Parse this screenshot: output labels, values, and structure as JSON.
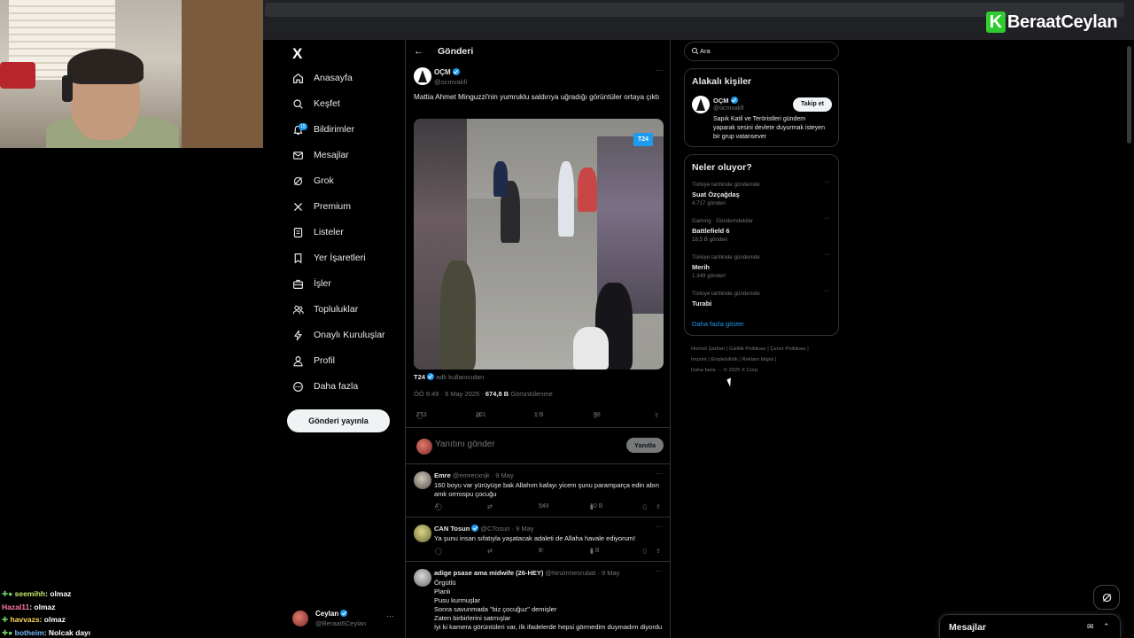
{
  "overlay": {
    "brand_letter": "K",
    "brand_name": "BeraatCeylan",
    "chat": [
      {
        "user": "seemihh",
        "text": ": olmaz"
      },
      {
        "user": "Hazal11",
        "text": ": olmaz"
      },
      {
        "user": "havvazs",
        "text": ": olmaz"
      },
      {
        "user": "botheim",
        "text": ": Nolcak dayı"
      }
    ]
  },
  "sidebar": {
    "logo": "X",
    "items": [
      {
        "label": "Anasayfa",
        "icon": "home-icon"
      },
      {
        "label": "Keşfet",
        "icon": "search-icon"
      },
      {
        "label": "Bildirimler",
        "icon": "bell-icon"
      },
      {
        "label": "Mesajlar",
        "icon": "mail-icon"
      },
      {
        "label": "Grok",
        "icon": "grok-icon"
      },
      {
        "label": "Premium",
        "icon": "x-logo-icon"
      },
      {
        "label": "Listeler",
        "icon": "list-icon"
      },
      {
        "label": "Yer İşaretleri",
        "icon": "bookmark-icon"
      },
      {
        "label": "İşler",
        "icon": "briefcase-icon"
      },
      {
        "label": "Topluluklar",
        "icon": "people-icon"
      },
      {
        "label": "Onaylı Kuruluşlar",
        "icon": "lightning-icon"
      },
      {
        "label": "Profil",
        "icon": "person-icon"
      },
      {
        "label": "Daha fazla",
        "icon": "more-circle-icon"
      }
    ],
    "notification_count": "15",
    "post_button": "Gönderi yayınla",
    "account": {
      "name": "Ceylan",
      "handle": "@Beraat6Ceylan",
      "more": "···"
    }
  },
  "main": {
    "title": "Gönderi",
    "tweet": {
      "author": "OÇM",
      "handle": "@ocmvakfi",
      "text": "Mattia Ahmet Minguzzi'nin yumruklu saldırıya uğradığı görüntüler ortaya çıktı",
      "media_badge": "T24",
      "source_name": "T24",
      "source_suffix": "adlı kullanıcıdan",
      "time": "ÖÖ 9:49 · 9 May 2025 · ",
      "views": "674,8 B",
      "views_label": " Görüntülenme",
      "replies": "273",
      "reposts": "201",
      "likes": "1 B",
      "bookmarks": "98"
    },
    "reply_placeholder": "Yanıtını gönder",
    "reply_button": "Yanıtla",
    "replies": [
      {
        "name": "Emre",
        "meta": " @emrecxnjk · 9 May",
        "text": "160 boyu var yürüyüşe bak Allahım kafayı yicem şunu paramparça edin abın amk orrrospu çocuğu",
        "replies": "4",
        "likes": "549",
        "views": "10 B"
      },
      {
        "name": "CAN Tosun",
        "meta": " @CTosun · 9 May",
        "text": "Ya şunu insan sıfatıyla yaşatacak adaleti de Allaha havale ediyorum!",
        "replies": "",
        "likes": "8",
        "views": "1 B"
      },
      {
        "name": "adige psase ama midwife (26-HEY)",
        "meta": " @hinzirmesrubat · 9 May",
        "text_lines": [
          "Örgütlü",
          "Planlı",
          "Pusu kurmuşlar",
          "Sonra savunmada \"biz çocuğuz\" demişler",
          "Zaten birbirlerini satmışlar",
          "İyi ki kamera görüntüleri var, ilk ifadelerde hepsi görmedim duymadım diyordu"
        ]
      }
    ]
  },
  "right": {
    "search_placeholder": "Ara",
    "relevant_title": "Alakalı kişiler",
    "relevant_person": {
      "name": "OÇM",
      "handle": "@ocmvakfi",
      "bio": "Sapık Katil ve Teröristleri gündem yaparak sesini devlete duyurmak isteyen bir grup vatansever",
      "follow": "Takip et"
    },
    "trends_title": "Neler oluyor?",
    "trends": [
      {
        "context": "Türkiye tarihinde gündemde",
        "title": "Suat Özçağdaş",
        "count": "4.717 gönderi"
      },
      {
        "context": "Gaming · Gündemdekiler",
        "title": "Battlefield 6",
        "count": "18,5 B gönderi"
      },
      {
        "context": "Türkiye tarihinde gündemde",
        "title": "Merih",
        "count": "1.349 gönderi"
      },
      {
        "context": "Türkiye tarihinde gündemde",
        "title": "Turabi",
        "count": ""
      }
    ],
    "show_more": "Daha fazla göster",
    "footer_lines": [
      "Hizmet Şartları  |  Gizlilik Politikası  |  Çerez Politikası  |",
      "Imprint  |  Erişilebilirlik  |  Reklam bilgisi  |",
      "Daha fazla ···  © 2025 X Corp."
    ]
  },
  "messages_drawer": {
    "title": "Mesajlar"
  }
}
